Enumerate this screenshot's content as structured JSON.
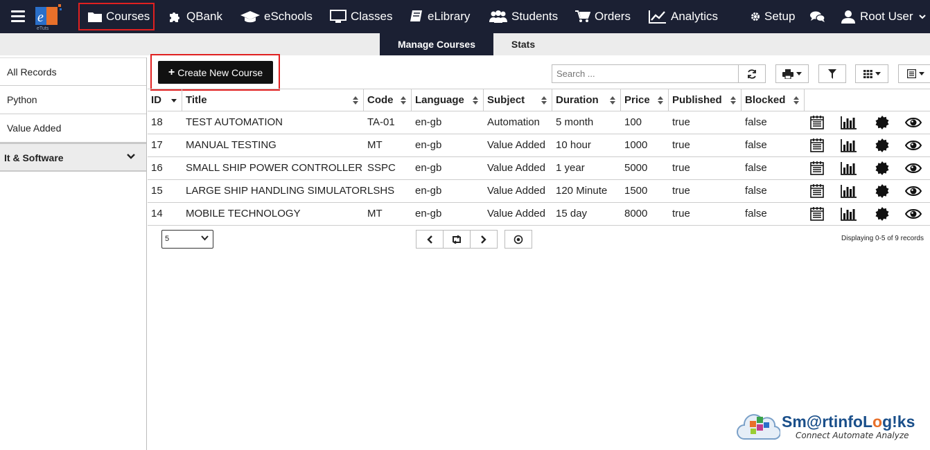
{
  "nav": {
    "logo_text": "eTuts",
    "items": [
      {
        "label": "Courses"
      },
      {
        "label": "QBank"
      },
      {
        "label": "eSchools"
      },
      {
        "label": "Classes"
      },
      {
        "label": "eLibrary"
      },
      {
        "label": "Students"
      },
      {
        "label": "Orders"
      },
      {
        "label": "Analytics"
      },
      {
        "label": "Setup"
      }
    ],
    "user": "Root User"
  },
  "subnav": {
    "tabs": [
      {
        "label": "Manage Courses",
        "active": true
      },
      {
        "label": "Stats",
        "active": false
      }
    ]
  },
  "sidebar": {
    "items": [
      {
        "label": "All Records"
      },
      {
        "label": "Python"
      },
      {
        "label": "Value Added"
      }
    ],
    "group": {
      "label": "It & Software"
    }
  },
  "toolbar": {
    "create_label": "Create New Course",
    "search_placeholder": "Search ..."
  },
  "table": {
    "columns": [
      "ID",
      "Title",
      "Code",
      "Language",
      "Subject",
      "Duration",
      "Price",
      "Published",
      "Blocked"
    ],
    "rows": [
      [
        "18",
        "TEST AUTOMATION",
        "TA-01",
        "en-gb",
        "Automation",
        "5 month",
        "100",
        "true",
        "false"
      ],
      [
        "17",
        "MANUAL TESTING",
        "MT",
        "en-gb",
        "Value Added",
        "10 hour",
        "1000",
        "true",
        "false"
      ],
      [
        "16",
        "SMALL SHIP POWER CONTROLLER",
        "SSPC",
        "en-gb",
        "Value Added",
        "1 year",
        "5000",
        "true",
        "false"
      ],
      [
        "15",
        "LARGE SHIP HANDLING SIMULATOR",
        "LSHS",
        "en-gb",
        "Value Added",
        "120 Minute",
        "1500",
        "true",
        "false"
      ],
      [
        "14",
        "MOBILE TECHNOLOGY",
        "MT",
        "en-gb",
        "Value Added",
        "15 day",
        "8000",
        "true",
        "false"
      ]
    ]
  },
  "pager": {
    "page_size": "5",
    "display_info": "Displaying 0-5 of 9 records"
  },
  "watermark": {
    "brand_prefix": "Sm@rtinfoL",
    "brand_o": "o",
    "brand_suffix": "g!ks",
    "tagline": "Connect Automate Analyze"
  },
  "colors": {
    "nav_bg": "#1b2033",
    "highlight": "#e02020",
    "brand_blue": "#1a4f8a",
    "brand_orange": "#e8702a"
  }
}
